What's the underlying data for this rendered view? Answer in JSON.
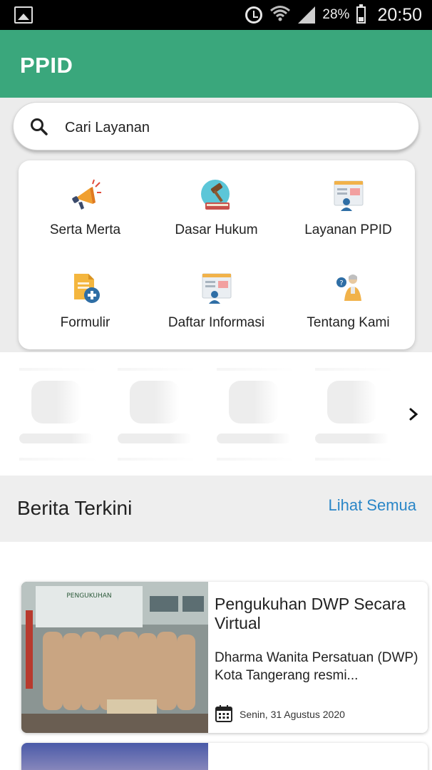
{
  "status_bar": {
    "battery_percent": "28%",
    "time": "20:50",
    "icons": [
      "image-icon",
      "alarm-icon",
      "wifi-icon",
      "signal-icon",
      "battery-icon"
    ]
  },
  "app_bar": {
    "title": "PPID",
    "color": "#3aa77c"
  },
  "search": {
    "placeholder": "Cari Layanan",
    "icon": "search-icon"
  },
  "menu": {
    "items": [
      {
        "label": "Serta Merta",
        "icon": "megaphone-icon"
      },
      {
        "label": "Dasar Hukum",
        "icon": "gavel-book-icon"
      },
      {
        "label": "Layanan PPID",
        "icon": "service-window-icon"
      },
      {
        "label": "Formulir",
        "icon": "form-add-icon"
      },
      {
        "label": "Daftar Informasi",
        "icon": "info-list-icon"
      },
      {
        "label": "Tentang Kami",
        "icon": "about-person-icon"
      }
    ]
  },
  "news": {
    "section_title": "Berita Terkini",
    "see_all": "Lihat Semua",
    "link_color": "#2a86c7",
    "items": [
      {
        "headline": "Pengukuhan DWP Secara Virtual",
        "summary": "Dharma Wanita Persatuan (DWP) Kota Tangerang resmi...",
        "date": "Senin, 31 Agustus 2020",
        "image_banner_text": "PENGUKUHAN"
      }
    ]
  }
}
